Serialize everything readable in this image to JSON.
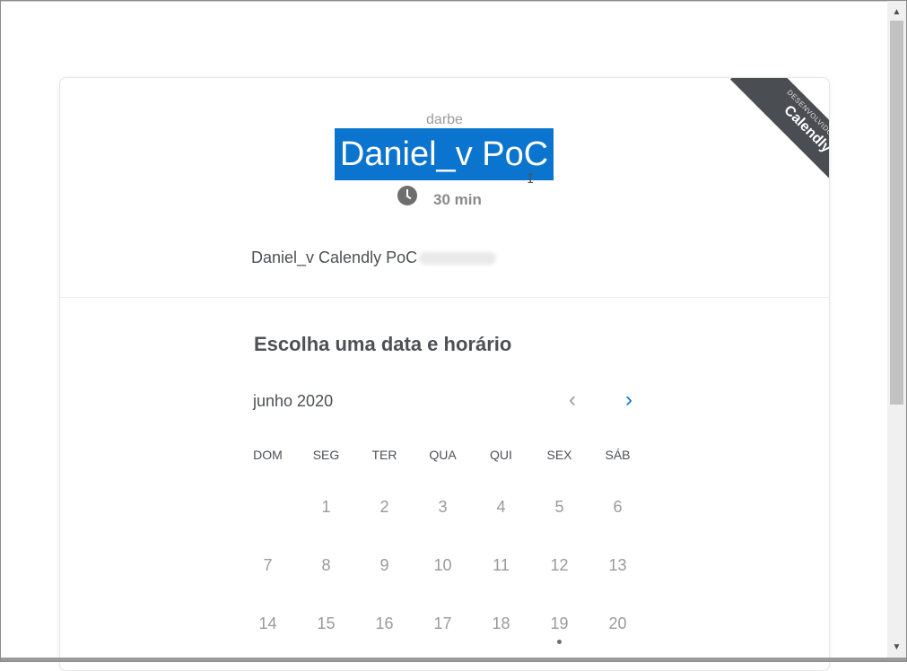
{
  "header": {
    "org_name": "darbe",
    "event_title": "Daniel_v PoC",
    "duration": "30 min"
  },
  "description": "Daniel_v Calendly PoC",
  "ribbon": {
    "small_text": "DESENVOLVIDO POR",
    "brand": "Calendly"
  },
  "scheduler": {
    "section_title": "Escolha uma data e horário",
    "month_label": "junho 2020",
    "prev_label": "‹",
    "next_label": "›",
    "weekdays": [
      "DOM",
      "SEG",
      "TER",
      "QUA",
      "QUI",
      "SEX",
      "SÁB"
    ],
    "weeks": [
      [
        "",
        "1",
        "2",
        "3",
        "4",
        "5",
        "6"
      ],
      [
        "7",
        "8",
        "9",
        "10",
        "11",
        "12",
        "13"
      ],
      [
        "14",
        "15",
        "16",
        "17",
        "18",
        "19",
        "20"
      ]
    ]
  },
  "colors": {
    "accent": "#0b74cf",
    "text_dark": "#4d5055",
    "text_muted": "#9a9a9a",
    "ribbon_bg": "#4a4d52"
  },
  "icons": {
    "clock": "clock-icon",
    "scroll_up": "arrow-up-icon",
    "scroll_down": "arrow-down-icon"
  }
}
